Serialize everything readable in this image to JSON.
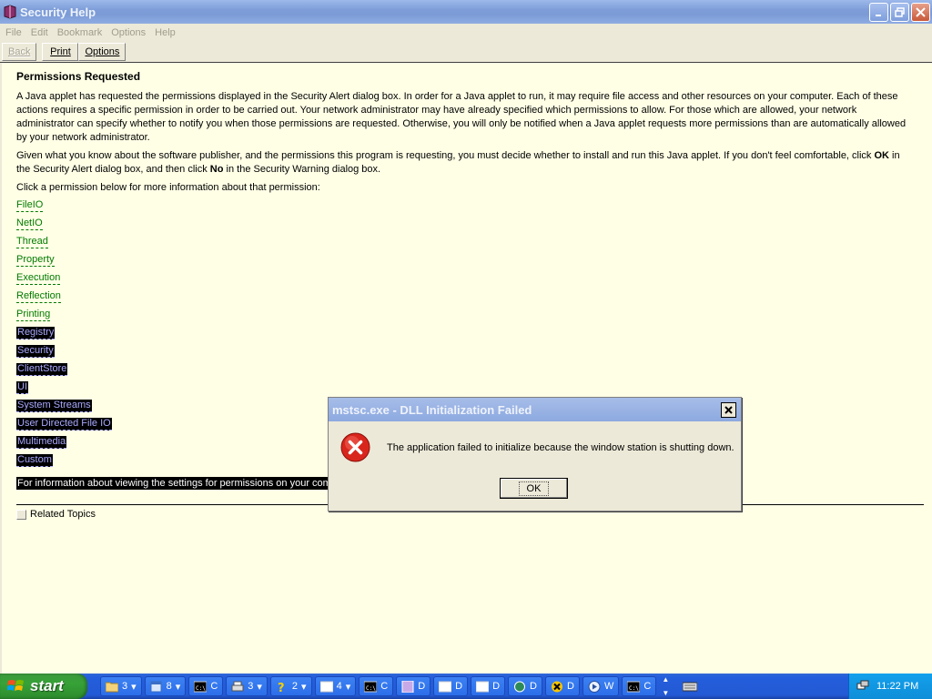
{
  "window": {
    "title": "Security Help"
  },
  "menu": [
    "File",
    "Edit",
    "Bookmark",
    "Options",
    "Help"
  ],
  "toolbar": {
    "back": "Back",
    "print": "Print",
    "options": "Options"
  },
  "content": {
    "heading": "Permissions Requested",
    "para1": "A Java applet has requested the permissions displayed in the Security Alert dialog box. In order for a Java applet to run, it may require file access and other resources on your computer. Each of these actions requires a specific permission in order to be carried out. Your network administrator may have already specified which permissions to allow. For those which are allowed, your network administrator can specify whether to notify you when those permissions are requested. Otherwise, you will only be notified when a Java applet requests more permissions than are automatically allowed by your network administrator.",
    "para2_a": "Given what you know about the software publisher, and the permissions this program is requesting, you must decide whether to install and run this Java applet. If you don't feel comfortable, click ",
    "para2_ok": "OK",
    "para2_b": " in the Security Alert dialog box, and then click ",
    "para2_no": "No",
    "para2_c": " in the Security Warning dialog box.",
    "para3": "Click a permission below for more information about that permission:",
    "links": [
      "FileIO",
      "NetIO",
      "Thread",
      "Property",
      "Execution",
      "Reflection",
      "Printing",
      "Registry",
      "Security",
      "ClientStore",
      "UI",
      "System Streams",
      "User Directed File IO",
      "Multimedia",
      "Custom"
    ],
    "info_line": "For information about viewing the settings for permissions on your compu",
    "related": "Related Topics"
  },
  "dialog": {
    "title": "mstsc.exe - DLL Initialization Failed",
    "message": "The application failed to initialize because the window station is shutting down.",
    "ok": "OK"
  },
  "taskbar": {
    "start": "start",
    "tasks": [
      {
        "icon": "folder-icon",
        "label": "3",
        "arrow": true
      },
      {
        "icon": "ie-icon",
        "label": "8",
        "arrow": true
      },
      {
        "icon": "cmd-icon",
        "label": "C",
        "arrow": false
      },
      {
        "icon": "printer-icon",
        "label": "3",
        "arrow": true
      },
      {
        "icon": "help-icon",
        "label": "2",
        "arrow": true
      },
      {
        "icon": "window-icon",
        "label": "4",
        "arrow": true
      },
      {
        "icon": "cmd-icon",
        "label": "C",
        "arrow": false
      },
      {
        "icon": "app-icon",
        "label": "D",
        "arrow": false
      },
      {
        "icon": "window-icon",
        "label": "D",
        "arrow": false
      },
      {
        "icon": "window-icon",
        "label": "D",
        "arrow": false
      },
      {
        "icon": "tool-icon",
        "label": "D",
        "arrow": false
      },
      {
        "icon": "x-app-icon",
        "label": "D",
        "arrow": false
      },
      {
        "icon": "media-icon",
        "label": "W",
        "arrow": false
      },
      {
        "icon": "cmd-icon",
        "label": "C",
        "arrow": false
      }
    ],
    "clock": "11:22 PM"
  }
}
